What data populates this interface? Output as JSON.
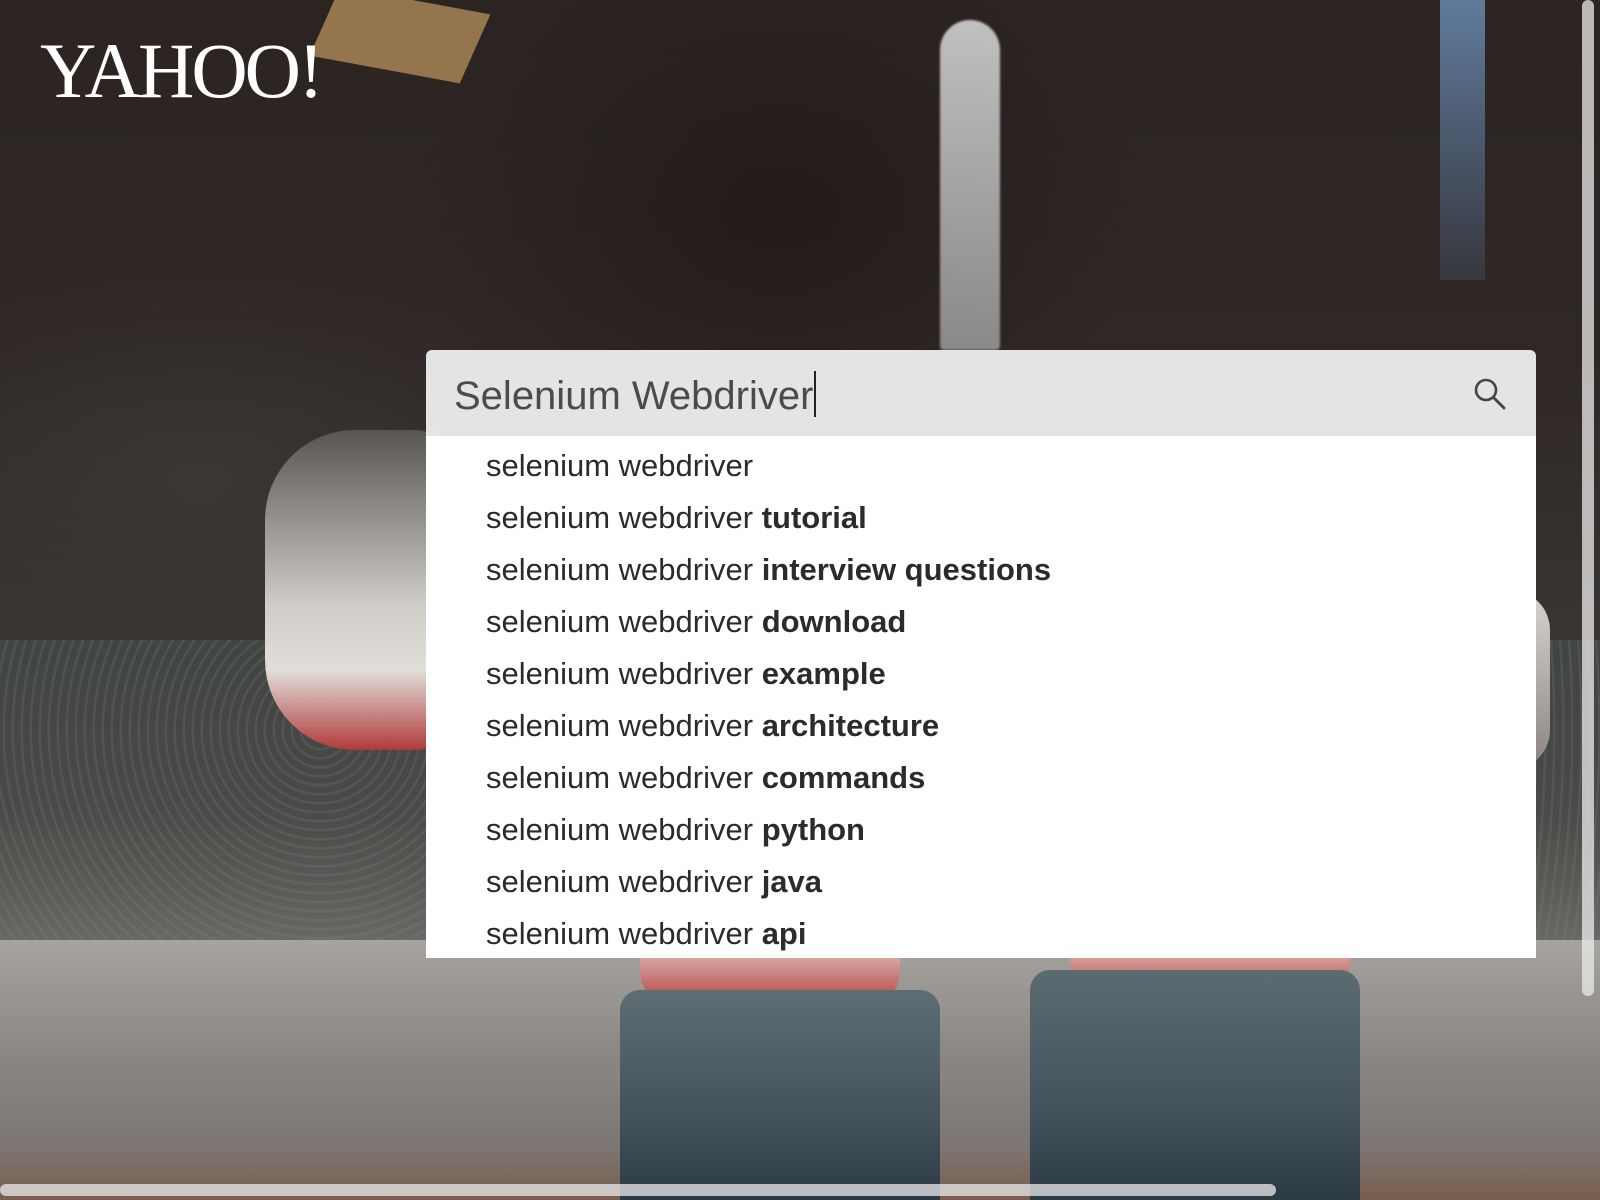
{
  "logo": {
    "text": "YAHOO!"
  },
  "search": {
    "value": "Selenium Webdriver",
    "icon": "search-icon"
  },
  "suggestions": [
    {
      "prefix": "selenium webdriver",
      "completion": ""
    },
    {
      "prefix": "selenium webdriver",
      "completion": "tutorial"
    },
    {
      "prefix": "selenium webdriver",
      "completion": "interview questions"
    },
    {
      "prefix": "selenium webdriver",
      "completion": "download"
    },
    {
      "prefix": "selenium webdriver",
      "completion": "example"
    },
    {
      "prefix": "selenium webdriver",
      "completion": "architecture"
    },
    {
      "prefix": "selenium webdriver",
      "completion": "commands"
    },
    {
      "prefix": "selenium webdriver",
      "completion": "python"
    },
    {
      "prefix": "selenium webdriver",
      "completion": "java"
    },
    {
      "prefix": "selenium webdriver",
      "completion": "api"
    }
  ]
}
